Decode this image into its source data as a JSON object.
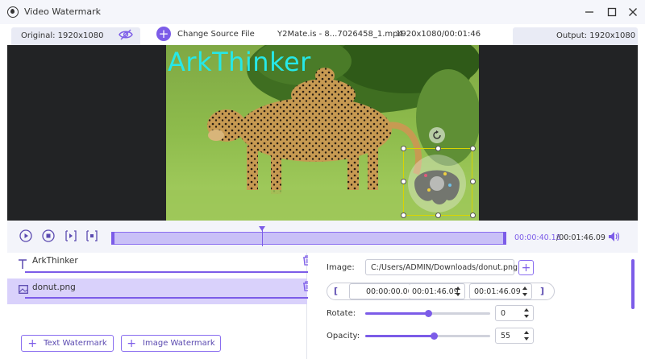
{
  "window": {
    "title": "Video Watermark"
  },
  "infobar": {
    "original": "Original: 1920x1080",
    "change_source": "Change Source File",
    "file_name": "Y2Mate.is - 8...7026458_1.mp4",
    "file_meta": "1920x1080/00:01:46",
    "output": "Output: 1920x1080"
  },
  "preview": {
    "watermark_text": "ArkThinker"
  },
  "playback": {
    "current_time": "00:00:40.18",
    "total_time": "/00:01:46.09",
    "progress_fraction": 0.38
  },
  "watermarks": {
    "items": [
      {
        "label": "ArkThinker",
        "kind": "text",
        "icon": "text-icon"
      },
      {
        "label": "donut.png",
        "kind": "image",
        "icon": "image-icon"
      }
    ],
    "add_text_label": "Text Watermark",
    "add_image_label": "Image Watermark"
  },
  "settings": {
    "image_label": "Image:",
    "image_path": "C:/Users/ADMIN/Downloads/donut.png",
    "start_time": "00:00:00.00",
    "end_time": "00:01:46.09",
    "duration": "00:01:46.09",
    "rotate_label": "Rotate:",
    "rotate_value": "0",
    "rotate_fraction": 0.5,
    "opacity_label": "Opacity:",
    "opacity_value": "55",
    "opacity_fraction": 0.55
  },
  "colors": {
    "accent": "#7c5ce8",
    "selected_bg": "#d9d1fb",
    "watermark_text": "#26e8e8",
    "preview_bg": "#222325"
  }
}
